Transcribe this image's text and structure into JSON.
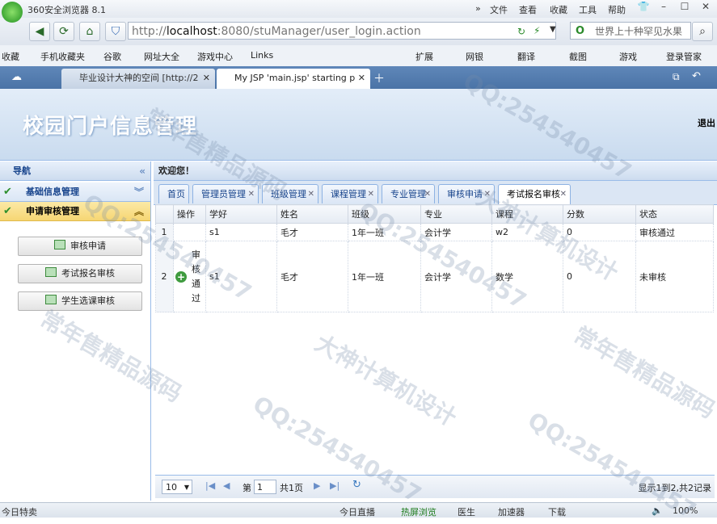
{
  "browser": {
    "title": "360安全浏览器 8.1",
    "menu": [
      "文件",
      "查看",
      "收藏",
      "工具",
      "帮助"
    ],
    "address": {
      "host": "localhost",
      "rest": ":8080/stuManager/user_login.action",
      "scheme": "http://"
    },
    "search_placeholder": "世界上十种罕见水果",
    "favorites": [
      "收藏",
      "手机收藏夹",
      "谷歌",
      "网址大全",
      "游戏中心",
      "Links",
      "扩展",
      "网银",
      "翻译",
      "截图",
      "游戏",
      "登录管家"
    ],
    "tabs": [
      {
        "label": "毕业设计大神的空间 [http://2"
      },
      {
        "label": "My JSP 'main.jsp' starting p"
      }
    ],
    "status": {
      "left": "今日特卖",
      "items": [
        "今日直播",
        "热屏浏览",
        "医生",
        "加速器",
        "下载"
      ],
      "zoom": "100%"
    }
  },
  "app": {
    "title": "校园门户信息管理",
    "logout": "退出",
    "nav": {
      "title": "导航",
      "sections": [
        {
          "label": "基础信息管理",
          "state": "collapsed"
        },
        {
          "label": "申请审核管理",
          "state": "expanded"
        }
      ],
      "buttons": [
        "审核申请",
        "考试报名审核",
        "学生选课审核"
      ]
    },
    "welcome": "欢迎您！",
    "tabs": [
      "首页",
      "管理员管理",
      "班级管理",
      "课程管理",
      "专业管理",
      "审核申请",
      "考试报名审核"
    ],
    "active_tab": "考试报名审核",
    "grid": {
      "columns": [
        "操作",
        "学好",
        "姓名",
        "班级",
        "专业",
        "课程",
        "分数",
        "状态"
      ],
      "rows": [
        {
          "rn": "1",
          "action": "",
          "xuehao": "s1",
          "name": "毛才",
          "class": "1年一班",
          "major": "会计学",
          "course": "w2",
          "score": "0",
          "status": "审核通过"
        },
        {
          "rn": "2",
          "action": "审核通过",
          "xuehao": "s1",
          "name": "毛才",
          "class": "1年一班",
          "major": "会计学",
          "course": "数学",
          "score": "0",
          "status": "未审核"
        }
      ]
    },
    "pager": {
      "page_size": "10",
      "page_prefix": "第",
      "page": "1",
      "page_suffix": "共1页",
      "summary": "显示1到2,共2记录"
    }
  },
  "watermarks": [
    "QQ:254540457",
    "常年售精品源码",
    "大神计算机设计"
  ]
}
